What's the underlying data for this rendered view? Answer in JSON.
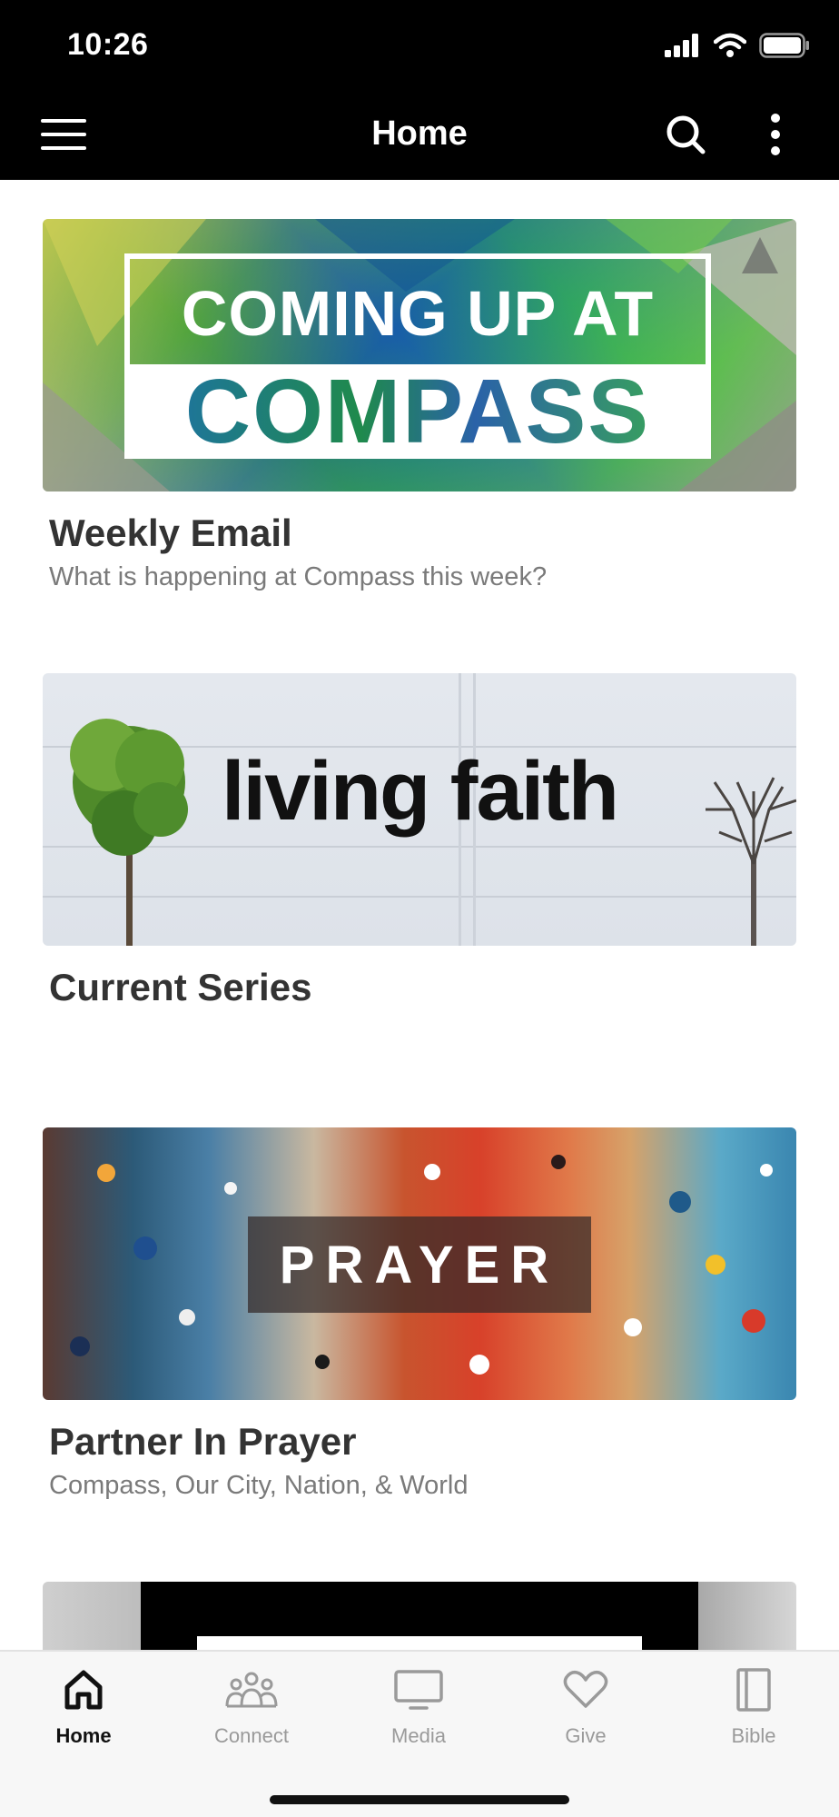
{
  "status": {
    "time": "10:26"
  },
  "nav": {
    "title": "Home"
  },
  "cards": [
    {
      "banner_text_1": "COMING UP AT",
      "banner_text_2": "COMPASS",
      "title": "Weekly Email",
      "subtitle": "What is happening at Compass this week?"
    },
    {
      "banner_text": "living faith",
      "title": "Current Series"
    },
    {
      "banner_text": "PRAYER",
      "title": "Partner In Prayer",
      "subtitle": "Compass, Our City, Nation, & World"
    }
  ],
  "tabs": [
    {
      "label": "Home",
      "icon": "home-icon",
      "active": true
    },
    {
      "label": "Connect",
      "icon": "people-icon"
    },
    {
      "label": "Media",
      "icon": "tv-icon"
    },
    {
      "label": "Give",
      "icon": "heart-icon"
    },
    {
      "label": "Bible",
      "icon": "book-icon"
    }
  ],
  "colors": {
    "bar": "#000000",
    "active_tab": "#111111",
    "inactive_tab": "#9a9a9a"
  }
}
